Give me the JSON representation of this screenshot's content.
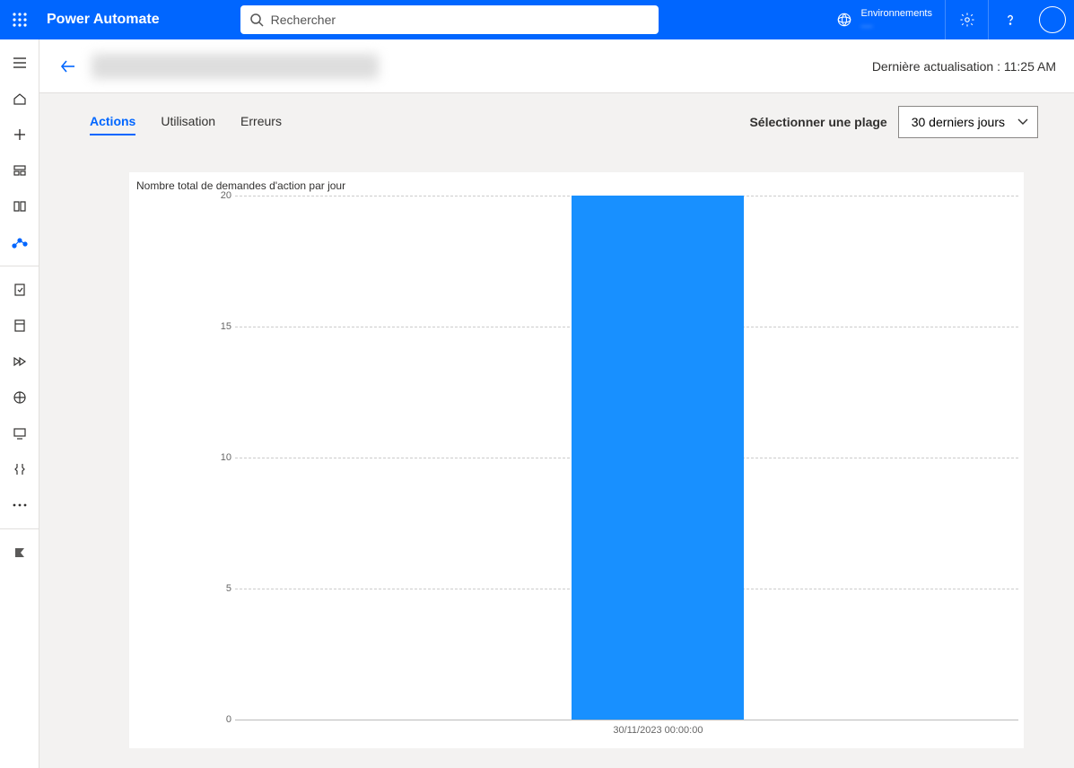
{
  "app": {
    "name": "Power Automate"
  },
  "search": {
    "placeholder": "Rechercher"
  },
  "env": {
    "label": "Environnements",
    "value": "—"
  },
  "titlebar": {
    "refresh": "Dernière actualisation : 11:25 AM"
  },
  "tabs": {
    "actions": "Actions",
    "usage": "Utilisation",
    "errors": "Erreurs"
  },
  "range": {
    "label": "Sélectionner une plage",
    "selected": "30 derniers jours"
  },
  "chart_data": {
    "type": "bar",
    "title": "Nombre total de demandes d'action par jour",
    "categories": [
      "30/11/2023 00:00:00"
    ],
    "values": [
      20
    ],
    "ylim": [
      0,
      20
    ],
    "yticks": [
      0,
      5,
      10,
      15,
      20
    ],
    "xlabel": "",
    "ylabel": ""
  }
}
